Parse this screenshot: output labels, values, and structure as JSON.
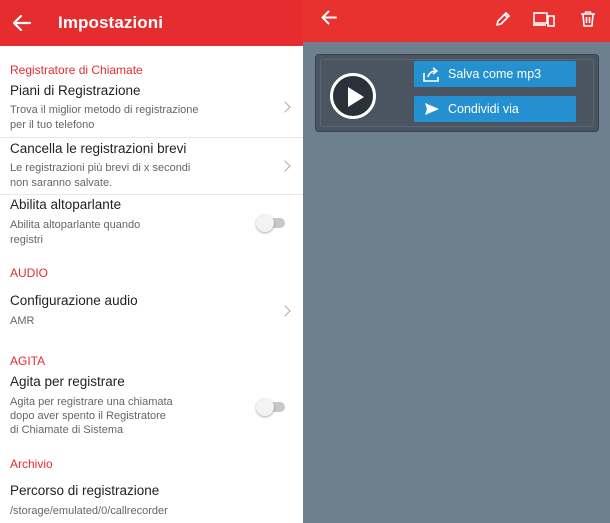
{
  "left_header": {
    "title": "Impostazioni"
  },
  "sections": {
    "recorder": "Registratore di Chiamate",
    "audio": "AUDIO",
    "shake": "AGITA",
    "archive": "Archivio"
  },
  "items": {
    "plans": {
      "title": "Piani di Registrazione",
      "sub1": "Trova il miglior metodo di registrazione",
      "sub2": "per il tuo telefono"
    },
    "delete_short": {
      "title": "Cancella le registrazioni brevi",
      "sub1": "Le registrazioni più brevi di x secondi",
      "sub2": "non saranno salvate."
    },
    "speaker": {
      "title": "Abilita altoparlante",
      "sub1": "Abilita altoparlante quando",
      "sub2": "registri",
      "enabled": false
    },
    "audio_config": {
      "title": "Configurazione audio",
      "value": "AMR"
    },
    "shake_record": {
      "title": "Agita per registrare",
      "sub1": "Agita per registrare una chiamata",
      "sub2": "dopo aver spento il Registratore",
      "sub3": "di Chiamate di Sistema",
      "enabled": false
    },
    "path": {
      "title": "Percorso di registrazione",
      "value": "/storage/emulated/0/callrecorder"
    }
  },
  "player": {
    "save_mp3": "Salva come mp3",
    "share_via": "Condividi via"
  },
  "colors": {
    "header_red": "#e52c2f",
    "accent_red": "#e52c2f",
    "button_blue": "#2590cf",
    "panel_gray": "#6e7f8d"
  }
}
